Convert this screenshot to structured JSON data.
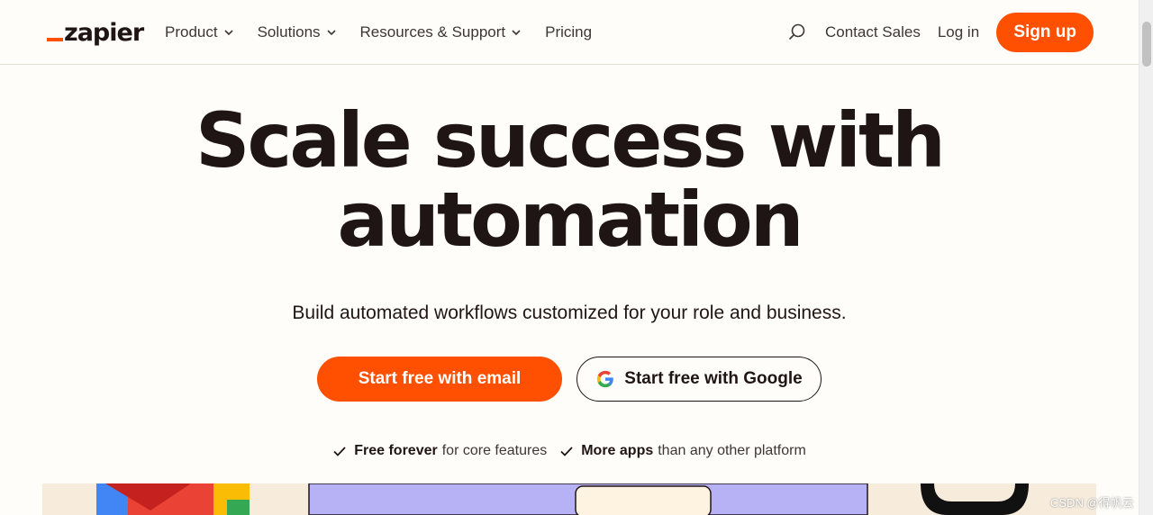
{
  "header": {
    "logo_text": "zapier",
    "nav": [
      {
        "label": "Product",
        "has_dropdown": true
      },
      {
        "label": "Solutions",
        "has_dropdown": true
      },
      {
        "label": "Resources & Support",
        "has_dropdown": true
      },
      {
        "label": "Pricing",
        "has_dropdown": false
      }
    ],
    "contact_sales": "Contact Sales",
    "login": "Log in",
    "signup": "Sign up"
  },
  "hero": {
    "headline_line1": "Scale success with",
    "headline_line2": "automation",
    "subhead": "Build automated workflows customized for your role and business.",
    "cta_email": "Start free with email",
    "cta_google": "Start free with Google",
    "features": [
      {
        "bold": "Free forever",
        "rest": "for core features"
      },
      {
        "bold": "More apps",
        "rest": "than any other platform"
      }
    ]
  },
  "watermark": "CSDN @得帆云",
  "colors": {
    "accent": "#ff4f00",
    "background": "#fffdf9",
    "text": "#201515"
  },
  "icons": [
    "search-icon",
    "chevron-down-icon",
    "google-icon",
    "check-icon"
  ]
}
